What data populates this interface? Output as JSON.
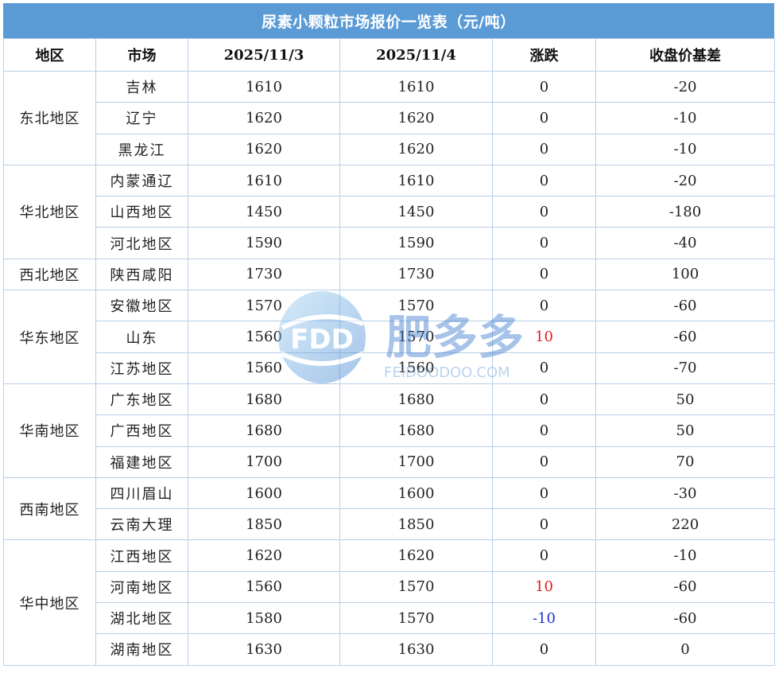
{
  "title": "尿素小颗粒市场报价一览表（元/吨）",
  "headers": [
    "地区",
    "市场",
    "2025/11/3",
    "2025/11/4",
    "涨跌",
    "收盘价基差"
  ],
  "groups": [
    {
      "region": "东北地区",
      "rows": [
        {
          "market": "吉林",
          "d1": "1610",
          "d2": "1610",
          "change": "0",
          "basis": "-20",
          "trend": "flat"
        },
        {
          "market": "辽宁",
          "d1": "1620",
          "d2": "1620",
          "change": "0",
          "basis": "-10",
          "trend": "flat"
        },
        {
          "market": "黑龙江",
          "d1": "1620",
          "d2": "1620",
          "change": "0",
          "basis": "-10",
          "trend": "flat"
        }
      ]
    },
    {
      "region": "华北地区",
      "rows": [
        {
          "market": "内蒙通辽",
          "d1": "1610",
          "d2": "1610",
          "change": "0",
          "basis": "-20",
          "trend": "flat"
        },
        {
          "market": "山西地区",
          "d1": "1450",
          "d2": "1450",
          "change": "0",
          "basis": "-180",
          "trend": "flat"
        },
        {
          "market": "河北地区",
          "d1": "1590",
          "d2": "1590",
          "change": "0",
          "basis": "-40",
          "trend": "flat"
        }
      ]
    },
    {
      "region": "西北地区",
      "rows": [
        {
          "market": "陕西咸阳",
          "d1": "1730",
          "d2": "1730",
          "change": "0",
          "basis": "100",
          "trend": "flat"
        }
      ]
    },
    {
      "region": "华东地区",
      "rows": [
        {
          "market": "安徽地区",
          "d1": "1570",
          "d2": "1570",
          "change": "0",
          "basis": "-60",
          "trend": "flat"
        },
        {
          "market": "山东",
          "d1": "1560",
          "d2": "1570",
          "change": "10",
          "basis": "-60",
          "trend": "up"
        },
        {
          "market": "江苏地区",
          "d1": "1560",
          "d2": "1560",
          "change": "0",
          "basis": "-70",
          "trend": "flat"
        }
      ]
    },
    {
      "region": "华南地区",
      "rows": [
        {
          "market": "广东地区",
          "d1": "1680",
          "d2": "1680",
          "change": "0",
          "basis": "50",
          "trend": "flat"
        },
        {
          "market": "广西地区",
          "d1": "1680",
          "d2": "1680",
          "change": "0",
          "basis": "50",
          "trend": "flat"
        },
        {
          "market": "福建地区",
          "d1": "1700",
          "d2": "1700",
          "change": "0",
          "basis": "70",
          "trend": "flat"
        }
      ]
    },
    {
      "region": "西南地区",
      "rows": [
        {
          "market": "四川眉山",
          "d1": "1600",
          "d2": "1600",
          "change": "0",
          "basis": "-30",
          "trend": "flat"
        },
        {
          "market": "云南大理",
          "d1": "1850",
          "d2": "1850",
          "change": "0",
          "basis": "220",
          "trend": "flat"
        }
      ]
    },
    {
      "region": "华中地区",
      "rows": [
        {
          "market": "江西地区",
          "d1": "1620",
          "d2": "1620",
          "change": "0",
          "basis": "-10",
          "trend": "flat"
        },
        {
          "market": "河南地区",
          "d1": "1560",
          "d2": "1570",
          "change": "10",
          "basis": "-60",
          "trend": "up"
        },
        {
          "market": "湖北地区",
          "d1": "1580",
          "d2": "1570",
          "change": "-10",
          "basis": "-60",
          "trend": "down"
        },
        {
          "market": "湖南地区",
          "d1": "1630",
          "d2": "1630",
          "change": "0",
          "basis": "0",
          "trend": "flat"
        }
      ]
    }
  ],
  "watermark": {
    "logo_text": "FDD",
    "brand": "肥多多",
    "url": "FEIDOODOO.COM"
  },
  "colors": {
    "header_bg": "#5b9bd5",
    "border": "#b8cfe6",
    "up": "#e0201c",
    "down": "#1f33d6"
  }
}
